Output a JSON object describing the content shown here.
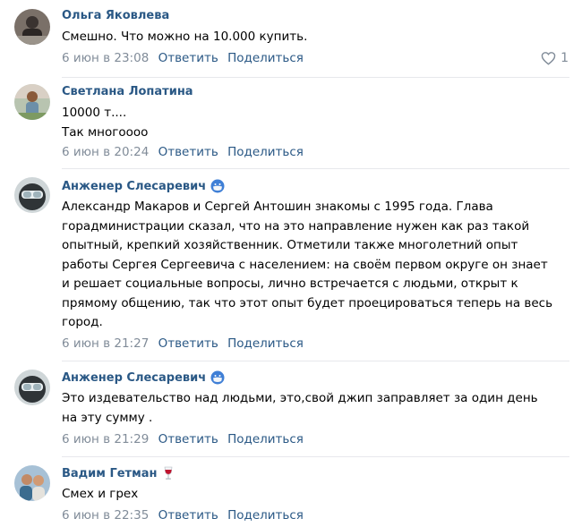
{
  "comments": [
    {
      "author": "Ольга Яковлева",
      "text": "Смешно. Что можно на 10.000 купить.",
      "date": "6 июн в 23:08",
      "reply_label": "Ответить",
      "share_label": "Поделиться",
      "likes": "1"
    },
    {
      "author": "Светлана Лопатина",
      "text": "10000 т....\nТак многоооо",
      "date": "6 июн в 20:24",
      "reply_label": "Ответить",
      "share_label": "Поделиться"
    },
    {
      "author": "Анженер Слесаревич",
      "text": "Александр Макаров и Сергей Антошин знакомы с 1995 года. Глава\nгорадминистрации сказал, что на это направление нужен как раз такой\nопытный, крепкий хозяйственник. Отметили также многолетний опыт\nработы Сергея Сергеевича с населением: на своём первом округе он знает\nи решает социальные вопросы, лично встречается с людьми, открыт к\nпрямому общению, так что этот опыт будет проецироваться теперь на весь\nгород.",
      "date": "6 июн в 21:27",
      "reply_label": "Ответить",
      "share_label": "Поделиться",
      "badge_icon": "face-with-medical-mask-icon"
    },
    {
      "author": "Анженер Слесаревич",
      "text": "Это издевательство над людьми, это,свой джип заправляет за один день\nна эту сумму .",
      "date": "6 июн в 21:29",
      "reply_label": "Ответить",
      "share_label": "Поделиться",
      "badge_icon": "face-with-medical-mask-icon"
    },
    {
      "author": "Вадим Гетман",
      "text": "Смех и грех",
      "date": "6 июн в 22:35",
      "reply_label": "Ответить",
      "share_label": "Поделиться",
      "badge_icon": "wine-glass-icon"
    }
  ],
  "colors": {
    "author": "#2a5885",
    "meta": "#818c99",
    "divider": "#e7e8ec"
  }
}
